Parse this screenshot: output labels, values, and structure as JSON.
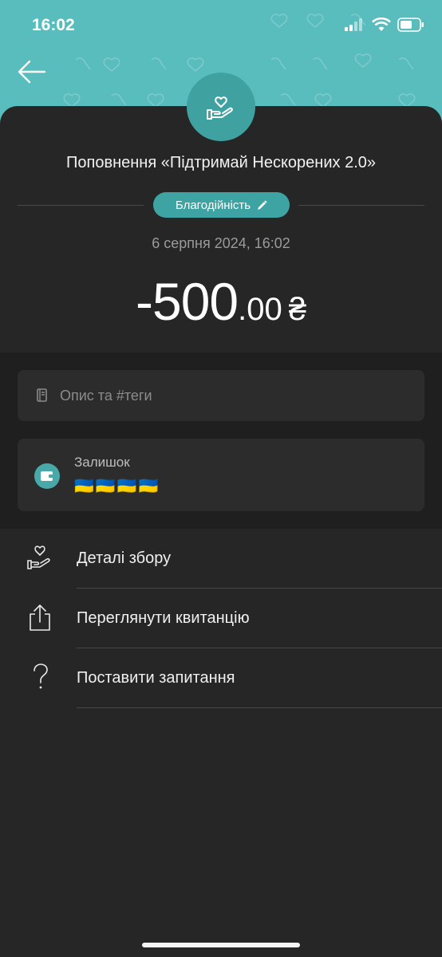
{
  "status_bar": {
    "time": "16:02"
  },
  "header": {
    "back_icon": "arrow-left-icon",
    "badge_icon": "heart-hand-icon",
    "accent_color": "#59bcbd"
  },
  "transaction": {
    "title": "Поповнення «Підтримай Нескорених 2.0»",
    "category": "Благодійність",
    "category_edit_icon": "pencil-icon",
    "date": "6 серпня 2024, 16:02",
    "amount_main": "-500",
    "amount_cents": ".00",
    "currency": "₴"
  },
  "description": {
    "placeholder": "Опис та #теги",
    "icon": "notebook-icon"
  },
  "balance": {
    "label": "Залишок",
    "value": "🇺🇦🇺🇦🇺🇦🇺🇦",
    "icon": "wallet-icon"
  },
  "menu": [
    {
      "label": "Деталі збору",
      "icon": "heart-hand-icon"
    },
    {
      "label": "Переглянути квитанцію",
      "icon": "share-icon"
    },
    {
      "label": "Поставити запитання",
      "icon": "question-icon"
    }
  ]
}
